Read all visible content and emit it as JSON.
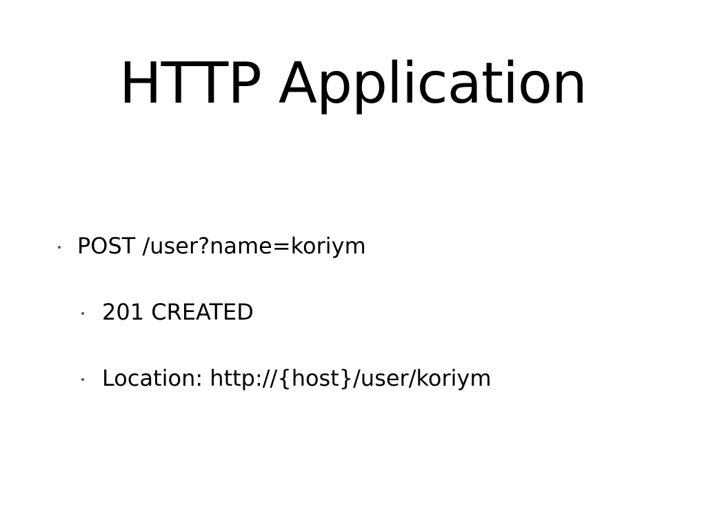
{
  "slide": {
    "title": "HTTP Application",
    "bullets": [
      {
        "text": "POST /user?name=koriym",
        "children": [
          {
            "text": "201 CREATED"
          },
          {
            "text": "Location: http://{host}/user/koriym"
          }
        ]
      }
    ]
  }
}
